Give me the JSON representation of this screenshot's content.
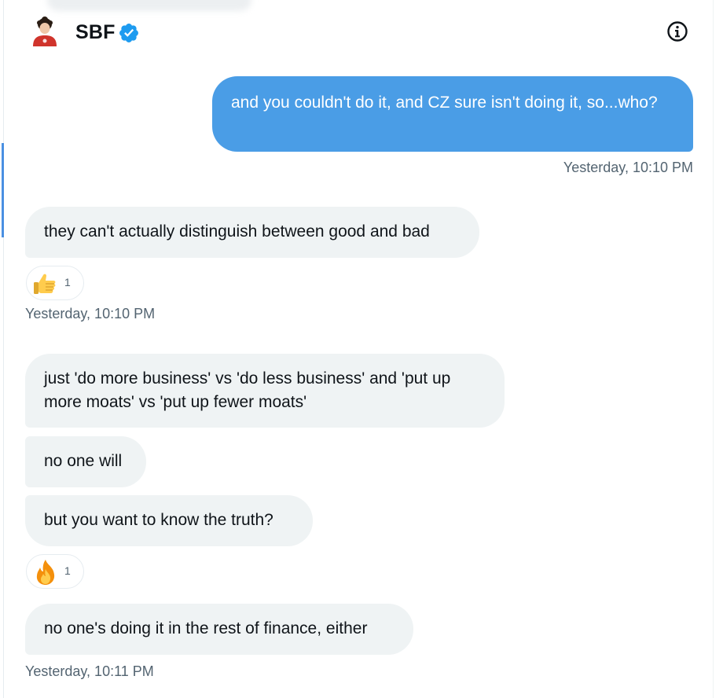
{
  "header": {
    "name": "SBF",
    "verified_icon": "verified-badge-icon",
    "info_icon": "info-icon",
    "accent": "#1d9bf0"
  },
  "messages": [
    {
      "type": "sent",
      "text": "and you couldn't do it, and CZ sure isn't doing it, so...who?"
    },
    {
      "type": "timestamp",
      "text": "Yesterday, 10:10 PM"
    },
    {
      "type": "received",
      "text": "they can't actually distinguish between good and bad"
    },
    {
      "type": "reaction",
      "emoji": "thumbs-up-icon",
      "count": "1"
    },
    {
      "type": "timestamp",
      "text": "Yesterday, 10:10 PM"
    },
    {
      "type": "received",
      "text": "just 'do more business' vs 'do less business' and 'put up more moats' vs 'put up fewer moats'"
    },
    {
      "type": "received",
      "text": "no one will"
    },
    {
      "type": "received",
      "text": "but you want to know the truth?"
    },
    {
      "type": "reaction",
      "emoji": "fire-icon",
      "count": "1"
    },
    {
      "type": "received",
      "text": "no one's doing it in the rest of finance, either"
    },
    {
      "type": "timestamp",
      "text": "Yesterday, 10:11 PM"
    }
  ],
  "colors": {
    "sent_bubble": "#4a9de6",
    "received_bubble": "#eff3f4",
    "timestamp": "#536471"
  }
}
